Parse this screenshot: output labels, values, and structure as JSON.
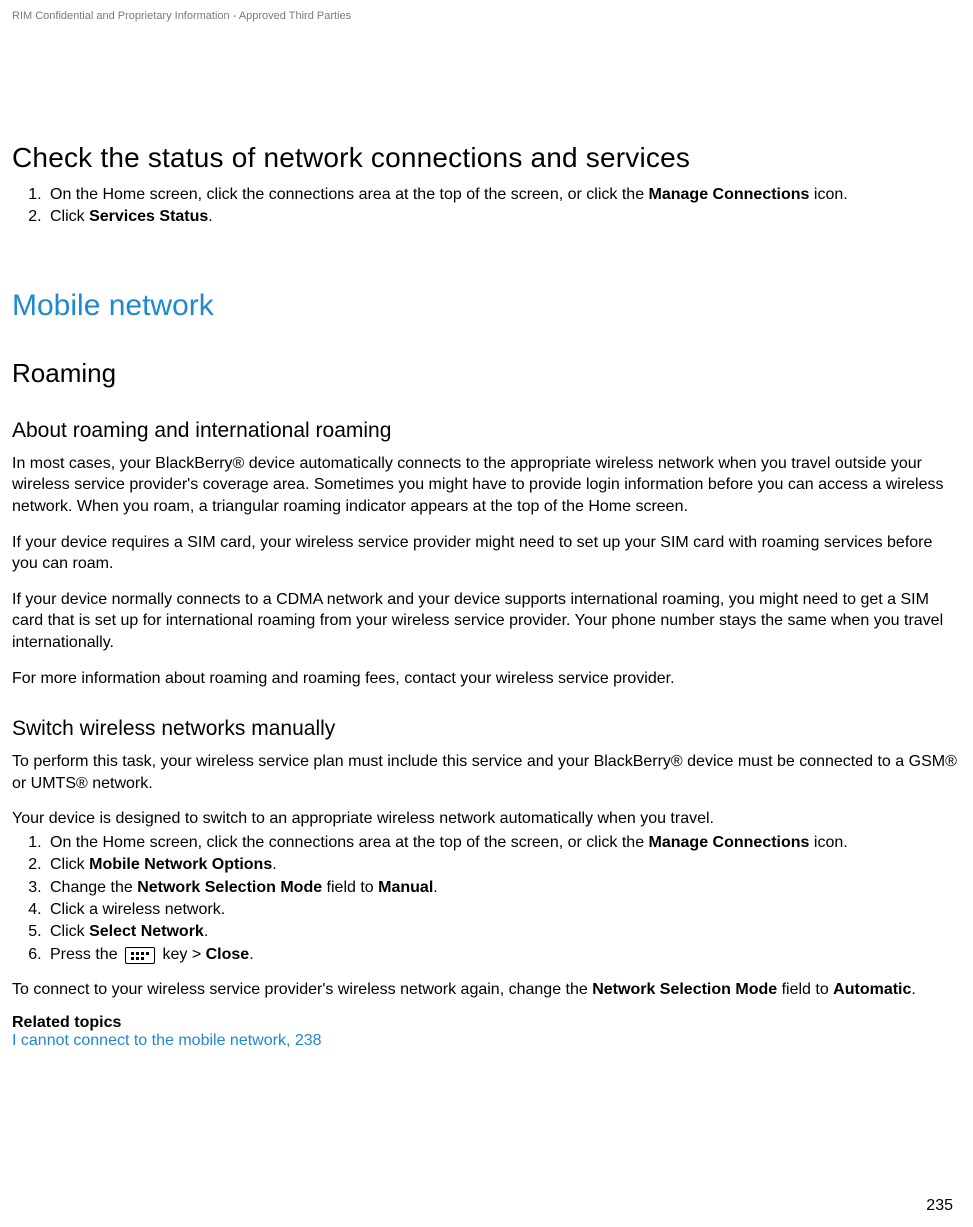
{
  "header": {
    "confidential": "RIM Confidential and Proprietary Information - Approved Third Parties"
  },
  "section1": {
    "title": "Check the status of network connections and services",
    "steps": [
      {
        "pre": "On the Home screen, click the connections area at the top of the screen, or click the ",
        "bold": "Manage Connections",
        "post": " icon."
      },
      {
        "pre": "Click ",
        "bold": "Services Status",
        "post": "."
      }
    ]
  },
  "section2": {
    "title": "Mobile network",
    "sub1": {
      "title": "Roaming",
      "block1": {
        "title": "About roaming and international roaming",
        "p1": "In most cases, your BlackBerry® device automatically connects to the appropriate wireless network when you travel outside your wireless service provider's coverage area. Sometimes you might have to provide login information before you can access a wireless network. When you roam, a triangular roaming indicator appears at the top of the Home screen.",
        "p2": "If your device requires a SIM card, your wireless service provider might need to set up your SIM card with roaming services before you can roam.",
        "p3": "If your device normally connects to a CDMA network and your device supports international roaming, you might need to get a SIM card that is set up for international roaming from your wireless service provider. Your phone number stays the same when you travel internationally.",
        "p4": "For more information about roaming and roaming fees, contact your wireless service provider."
      },
      "block2": {
        "title": "Switch wireless networks manually",
        "p1": "To perform this task, your wireless service plan must include this service and your BlackBerry® device must be connected to a GSM® or UMTS® network.",
        "p2": "Your device is designed to switch to an appropriate wireless network automatically when you travel.",
        "steps": {
          "s1": {
            "pre": "On the Home screen, click the connections area at the top of the screen, or click the ",
            "bold": "Manage Connections",
            "post": " icon."
          },
          "s2": {
            "pre": "Click ",
            "bold": "Mobile Network Options",
            "post": "."
          },
          "s3": {
            "pre": "Change the ",
            "bold1": "Network Selection Mode",
            "mid": " field to ",
            "bold2": "Manual",
            "post": "."
          },
          "s4": {
            "text": "Click a wireless network."
          },
          "s5": {
            "pre": "Click ",
            "bold": "Select Network",
            "post": "."
          },
          "s6": {
            "pre": "Press the ",
            "mid": " key > ",
            "bold": "Close",
            "post": "."
          }
        },
        "p3": {
          "pre": "To connect to your wireless service provider's wireless network again, change the ",
          "bold1": "Network Selection Mode",
          "mid": " field to ",
          "bold2": "Automatic",
          "post": "."
        },
        "related_label": "Related topics",
        "related_link": "I cannot connect to the mobile network, 238"
      }
    }
  },
  "page_number": "235"
}
